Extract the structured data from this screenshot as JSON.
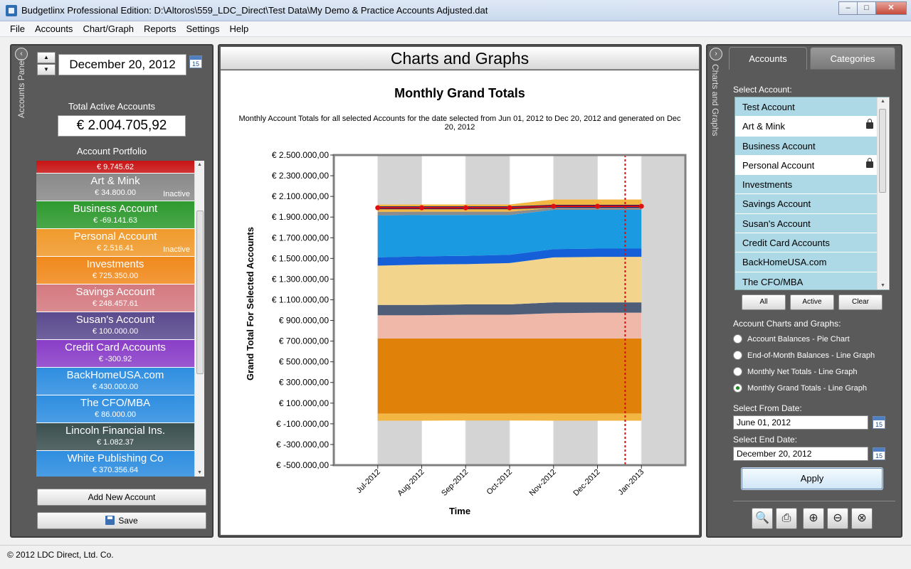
{
  "window": {
    "title": "Budgetlinx Professional Edition: D:\\Altoros\\559_LDC_Direct\\Test Data\\My Demo & Practice Accounts Adjusted.dat",
    "minimize_label": "–",
    "maximize_label": "□",
    "close_label": "✕"
  },
  "menu": {
    "file": "File",
    "accounts": "Accounts",
    "chart_graph": "Chart/Graph",
    "reports": "Reports",
    "settings": "Settings",
    "help": "Help"
  },
  "left_panel": {
    "panel_label": "Accounts Panel",
    "collapse_icon": "‹",
    "date": "December 20, 2012",
    "calendar_day": "15",
    "total_heading": "Total Active Accounts",
    "total_value": "€ 2.004.705,92",
    "portfolio_heading": "Account Portfolio",
    "accounts": [
      {
        "name": "",
        "balance": "€ 9.745.62",
        "status": "",
        "color": "#c81414"
      },
      {
        "name": "Art & Mink",
        "balance": "€ 34.800.00",
        "status": "Inactive",
        "color": "#8a8a8a"
      },
      {
        "name": "Business Account",
        "balance": "€ -69.141.63",
        "status": "",
        "color": "#2e9a2e"
      },
      {
        "name": "Personal Account",
        "balance": "€ 2.516.41",
        "status": "Inactive",
        "color": "#f09a2c"
      },
      {
        "name": "Investments",
        "balance": "€ 725.350.00",
        "status": "",
        "color": "#f0891c"
      },
      {
        "name": "Savings Account",
        "balance": "€ 248.457.61",
        "status": "",
        "color": "#d47a80"
      },
      {
        "name": "Susan's Account",
        "balance": "€ 100.000.00",
        "status": "",
        "color": "#5a4a8e"
      },
      {
        "name": "Credit Card Accounts",
        "balance": "€ -300.92",
        "status": "",
        "color": "#8a3ec8"
      },
      {
        "name": "BackHomeUSA.com",
        "balance": "€ 430.000.00",
        "status": "",
        "color": "#2f8ee0"
      },
      {
        "name": "The CFO/MBA",
        "balance": "€ 86.000.00",
        "status": "",
        "color": "#2f8ee0"
      },
      {
        "name": "Lincoln Financial Ins.",
        "balance": "€ 1.082.37",
        "status": "",
        "color": "#3c5050"
      },
      {
        "name": "White Publishing Co",
        "balance": "€ 370.356.64",
        "status": "",
        "color": "#2f8ee0"
      }
    ],
    "add_button": "Add New Account",
    "save_button": "Save"
  },
  "center": {
    "header": "Charts and Graphs"
  },
  "chart_data": {
    "type": "area",
    "title": "Monthly Grand Totals",
    "subtitle": "Monthly Account Totals for all selected Accounts for the date selected from Jun 01, 2012 to Dec 20, 2012 and generated on Dec 20, 2012",
    "xlabel": "Time",
    "ylabel": "Grand Total For Selected Accounts",
    "x": [
      "Jul-2012",
      "Aug-2012",
      "Sep-2012",
      "Oct-2012",
      "Nov-2012",
      "Dec-2012",
      "Jan-2013"
    ],
    "ylim": [
      -500000,
      2500000
    ],
    "y_ticks": [
      "€ 2.500.000,00",
      "€ 2.300.000,00",
      "€ 2.100.000,00",
      "€ 1.900.000,00",
      "€ 1.700.000,00",
      "€ 1.500.000,00",
      "€ 1.300.000,00",
      "€ 1.100.000,00",
      "€ 900.000,00",
      "€ 700.000,00",
      "€ 500.000,00",
      "€ 300.000,00",
      "€ 100.000,00",
      "€ -100.000,00",
      "€ -300.000,00",
      "€ -500.000,00"
    ],
    "stacked_band_boundaries": [
      {
        "color": "#f4b642",
        "lower": [
          -70000,
          -70000,
          -68000,
          -68000,
          -70000,
          -70000,
          -70000
        ],
        "upper": [
          0,
          0,
          0,
          0,
          0,
          0,
          0
        ]
      },
      {
        "color": "#e0820a",
        "lower": [
          0,
          0,
          0,
          0,
          0,
          0,
          0
        ],
        "upper": [
          725000,
          725000,
          725000,
          725000,
          725000,
          725000,
          725000
        ]
      },
      {
        "color": "#f0b8a8",
        "lower": [
          725000,
          725000,
          725000,
          725000,
          725000,
          725000,
          725000
        ],
        "upper": [
          950000,
          950000,
          955000,
          955000,
          970000,
          975000,
          975000
        ]
      },
      {
        "color": "#4e5e78",
        "lower": [
          950000,
          950000,
          955000,
          955000,
          970000,
          975000,
          975000
        ],
        "upper": [
          1050000,
          1050000,
          1055000,
          1055000,
          1075000,
          1075000,
          1075000
        ]
      },
      {
        "color": "#f2d48c",
        "lower": [
          1050000,
          1050000,
          1055000,
          1055000,
          1075000,
          1075000,
          1075000
        ],
        "upper": [
          1430000,
          1440000,
          1445000,
          1455000,
          1510000,
          1515000,
          1515000
        ]
      },
      {
        "color": "#1560d8",
        "lower": [
          1430000,
          1440000,
          1445000,
          1455000,
          1510000,
          1515000,
          1515000
        ],
        "upper": [
          1510000,
          1520000,
          1525000,
          1535000,
          1590000,
          1595000,
          1595000
        ]
      },
      {
        "color": "#1a9ae0",
        "lower": [
          1510000,
          1520000,
          1525000,
          1535000,
          1590000,
          1595000,
          1595000
        ],
        "upper": [
          1915000,
          1920000,
          1920000,
          1920000,
          1970000,
          1970000,
          1970000
        ]
      },
      {
        "color": "#8c8c8c",
        "lower": [
          1915000,
          1920000,
          1920000,
          1920000,
          1970000,
          1970000,
          1970000
        ],
        "upper": [
          1950000,
          1952000,
          1952000,
          1952000,
          1990000,
          1992000,
          1992000
        ]
      },
      {
        "color": "#f4b642",
        "lower": [
          1950000,
          1952000,
          1952000,
          1952000,
          1990000,
          1992000,
          1992000
        ],
        "upper": [
          2020000,
          2022000,
          2022000,
          2022000,
          2070000,
          2070000,
          2070000
        ]
      }
    ],
    "total_line": {
      "color": "#e01010",
      "values": [
        1990000,
        1990000,
        1990000,
        1990000,
        2005000,
        2005000,
        2005000
      ]
    },
    "current_date_marker": "Dec 20, 2012",
    "background_bands": true
  },
  "right_panel": {
    "panel_label": "Charts and Graphs",
    "collapse_icon": "›",
    "tab_accounts": "Accounts",
    "tab_categories": "Categories",
    "select_account_label": "Select Account:",
    "accounts": [
      {
        "name": "Test Account",
        "selected": true,
        "locked": false
      },
      {
        "name": "Art & Mink",
        "selected": false,
        "locked": true
      },
      {
        "name": "Business Account",
        "selected": true,
        "locked": false
      },
      {
        "name": "Personal Account",
        "selected": false,
        "locked": true
      },
      {
        "name": "Investments",
        "selected": true,
        "locked": false
      },
      {
        "name": "Savings Account",
        "selected": true,
        "locked": false
      },
      {
        "name": "Susan's Account",
        "selected": true,
        "locked": false
      },
      {
        "name": "Credit Card Accounts",
        "selected": true,
        "locked": false
      },
      {
        "name": "BackHomeUSA.com",
        "selected": true,
        "locked": false
      },
      {
        "name": "The CFO/MBA",
        "selected": true,
        "locked": false
      }
    ],
    "btn_all": "All",
    "btn_active": "Active",
    "btn_clear": "Clear",
    "charts_label": "Account Charts and Graphs:",
    "chart_options": [
      {
        "label": "Account Balances - Pie Chart",
        "checked": false
      },
      {
        "label": "End-of-Month Balances - Line Graph",
        "checked": false
      },
      {
        "label": "Monthly Net Totals - Line Graph",
        "checked": false
      },
      {
        "label": "Monthly Grand Totals - Line Graph",
        "checked": true
      }
    ],
    "from_label": "Select From Date:",
    "from_value": "June 01, 2012",
    "end_label": "Select End Date:",
    "end_value": "December 20, 2012",
    "calendar_day": "15",
    "apply": "Apply",
    "tools": [
      "preview-icon",
      "print-icon",
      "zoom-in-icon",
      "zoom-out-icon",
      "zoom-reset-icon"
    ]
  },
  "status": {
    "copyright": "© 2012 LDC Direct, Ltd. Co."
  }
}
